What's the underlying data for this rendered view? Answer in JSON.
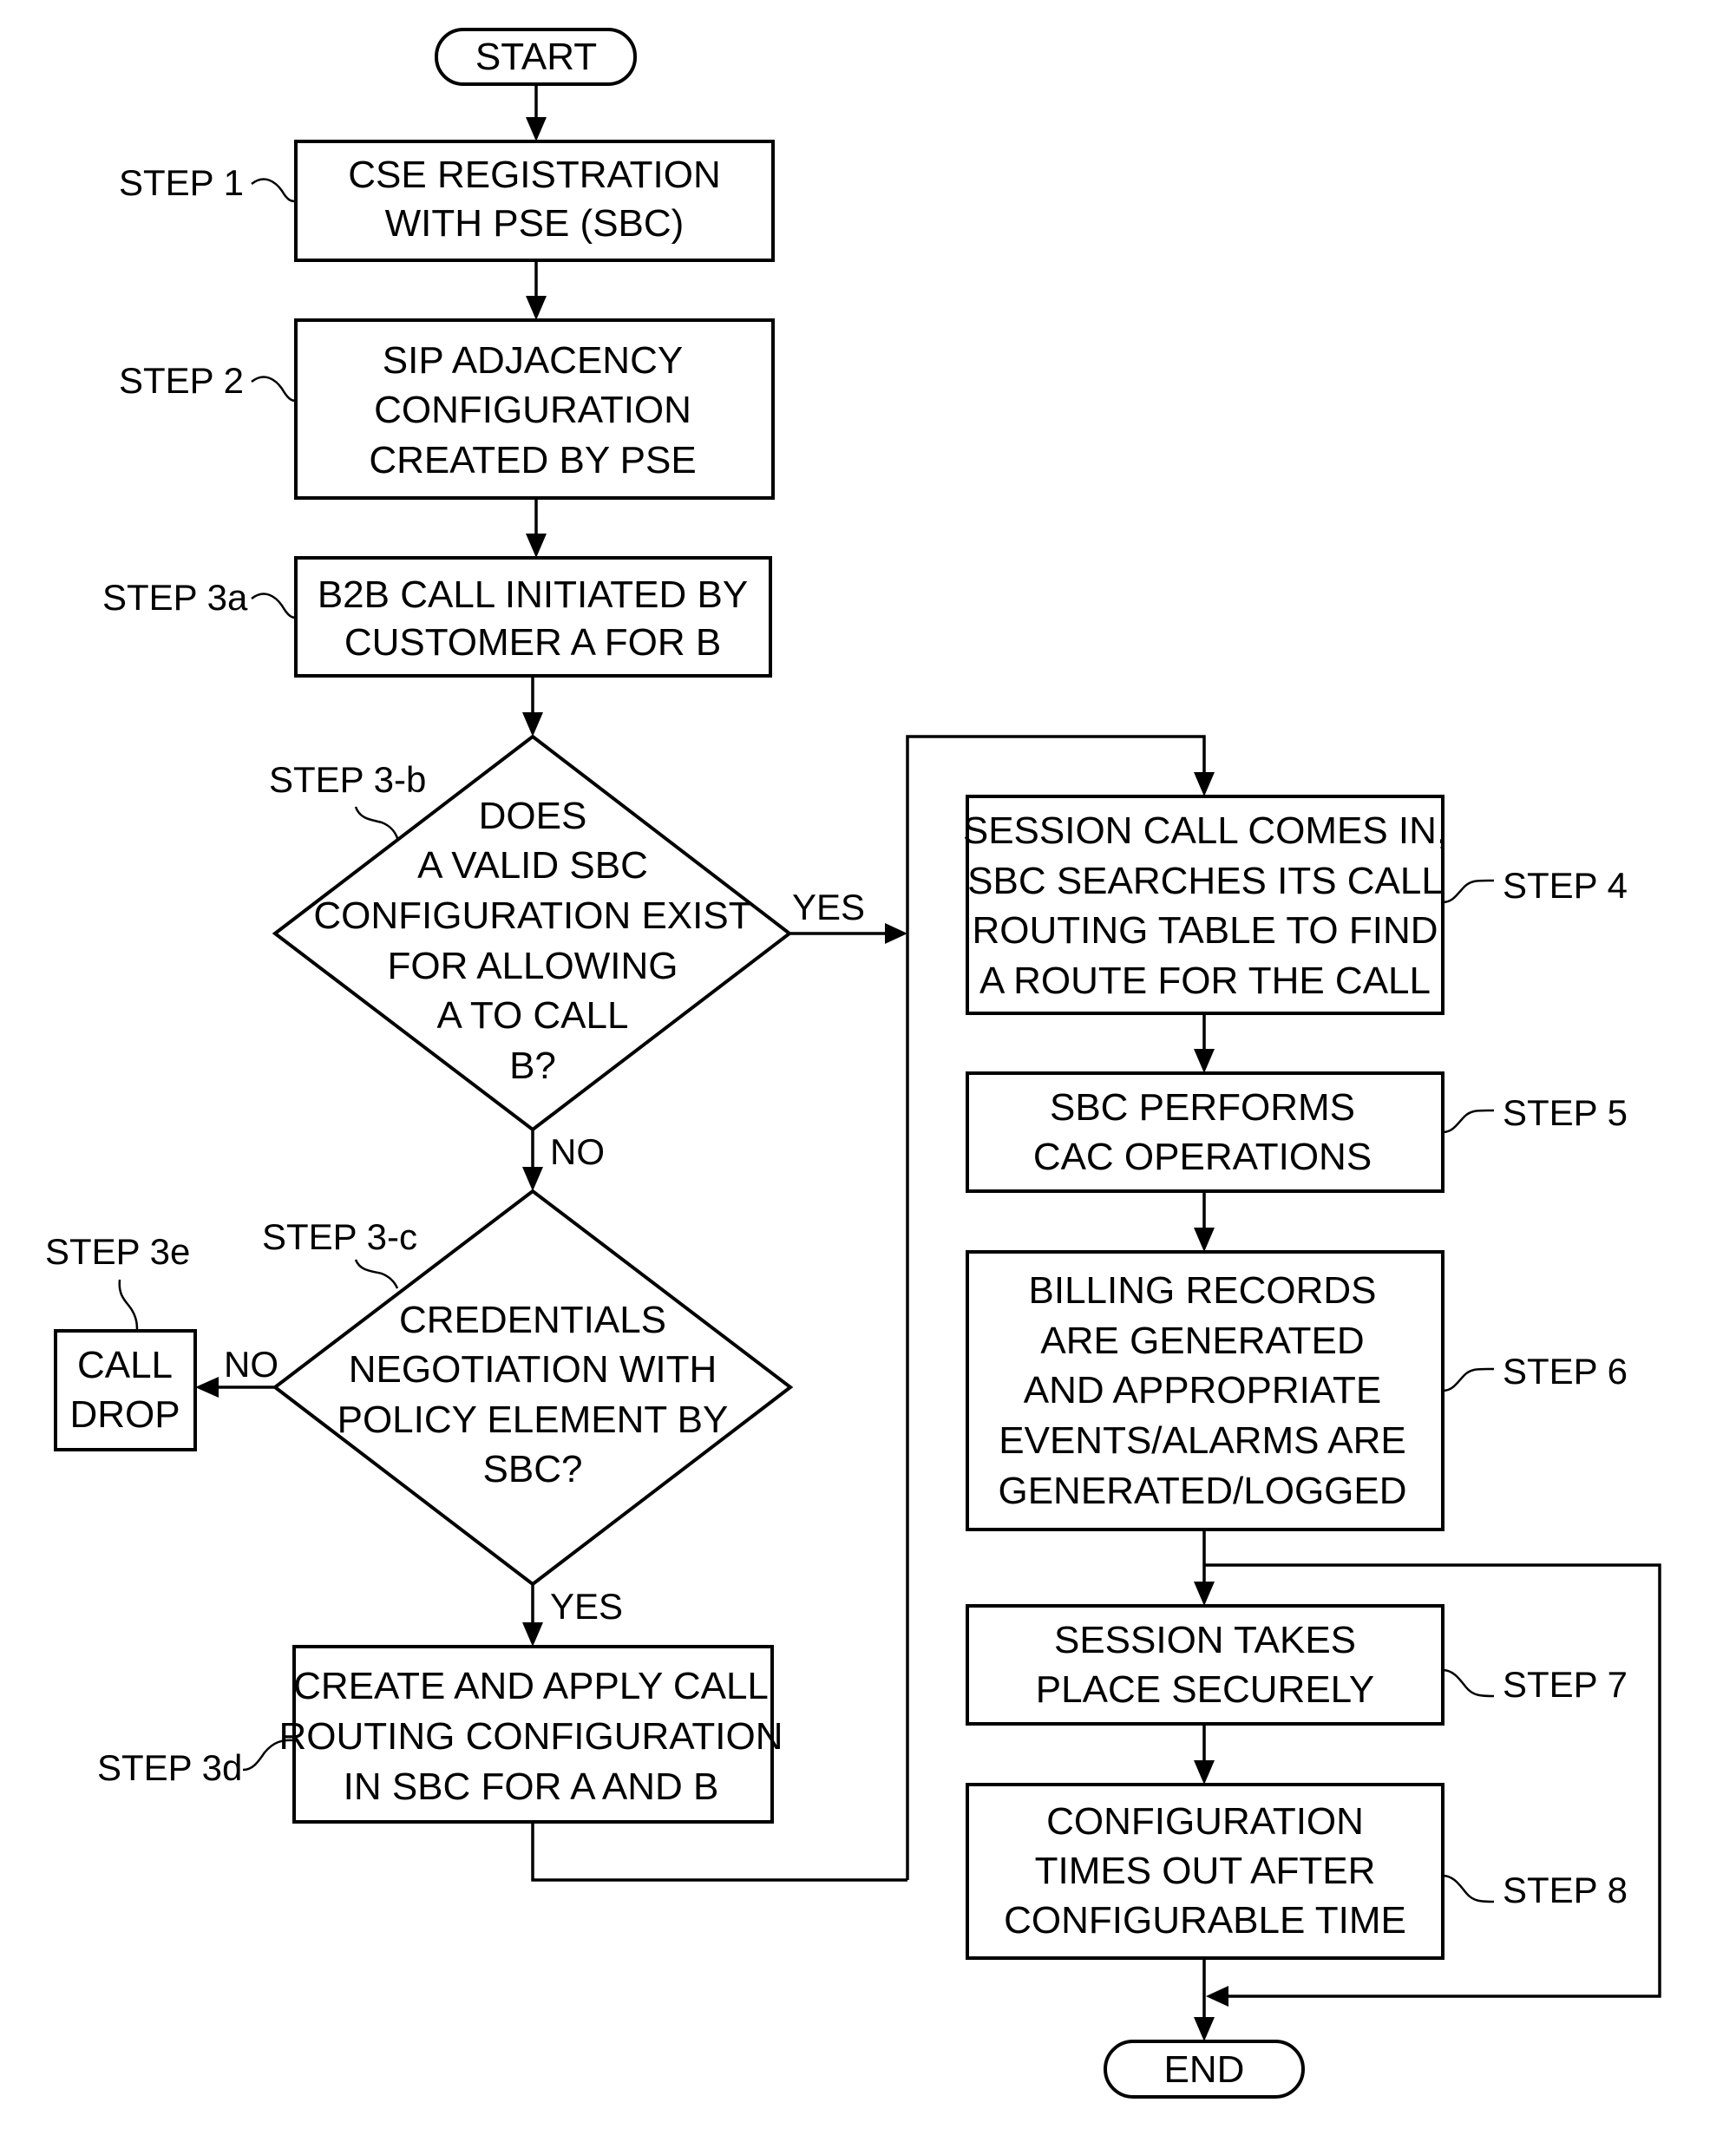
{
  "diagram": {
    "type": "flowchart",
    "terminals": {
      "start": "START",
      "end": "END"
    },
    "steps": {
      "step1": {
        "label": "STEP 1",
        "lines": [
          "CSE REGISTRATION",
          "WITH PSE (SBC)"
        ]
      },
      "step2": {
        "label": "STEP 2",
        "lines": [
          "SIP ADJACENCY",
          "CONFIGURATION",
          "CREATED BY PSE"
        ]
      },
      "step3a": {
        "label": "STEP 3a",
        "lines": [
          "B2B CALL INITIATED BY",
          "CUSTOMER A FOR B"
        ]
      },
      "step3b": {
        "label": "STEP 3-b",
        "lines": [
          "DOES",
          "A VALID SBC",
          "CONFIGURATION EXIST",
          "FOR ALLOWING",
          "A TO CALL",
          "B?"
        ]
      },
      "step3c": {
        "label": "STEP 3-c",
        "lines": [
          "CREDENTIALS",
          "NEGOTIATION WITH",
          "POLICY ELEMENT BY",
          "SBC?"
        ]
      },
      "step3d": {
        "label": "STEP 3d",
        "lines": [
          "CREATE AND APPLY CALL",
          "ROUTING CONFIGURATION",
          "IN SBC FOR A AND B"
        ]
      },
      "step3e": {
        "label": "STEP 3e",
        "lines": [
          "CALL",
          "DROP"
        ]
      },
      "step4": {
        "label": "STEP 4",
        "lines": [
          "SESSION CALL COMES IN,",
          "SBC SEARCHES ITS CALL",
          "ROUTING TABLE TO FIND",
          "A ROUTE FOR THE CALL"
        ]
      },
      "step5": {
        "label": "STEP 5",
        "lines": [
          "SBC PERFORMS",
          "CAC OPERATIONS"
        ]
      },
      "step6": {
        "label": "STEP 6",
        "lines": [
          "BILLING RECORDS",
          "ARE GENERATED",
          "AND APPROPRIATE",
          "EVENTS/ALARMS ARE",
          "GENERATED/LOGGED"
        ]
      },
      "step7": {
        "label": "STEP 7",
        "lines": [
          "SESSION TAKES",
          "PLACE SECURELY"
        ]
      },
      "step8": {
        "label": "STEP 8",
        "lines": [
          "CONFIGURATION",
          "TIMES OUT AFTER",
          "CONFIGURABLE TIME"
        ]
      }
    },
    "edge_labels": {
      "step3b_yes": "YES",
      "step3b_no": "NO",
      "step3c_yes": "YES",
      "step3c_no": "NO"
    }
  }
}
